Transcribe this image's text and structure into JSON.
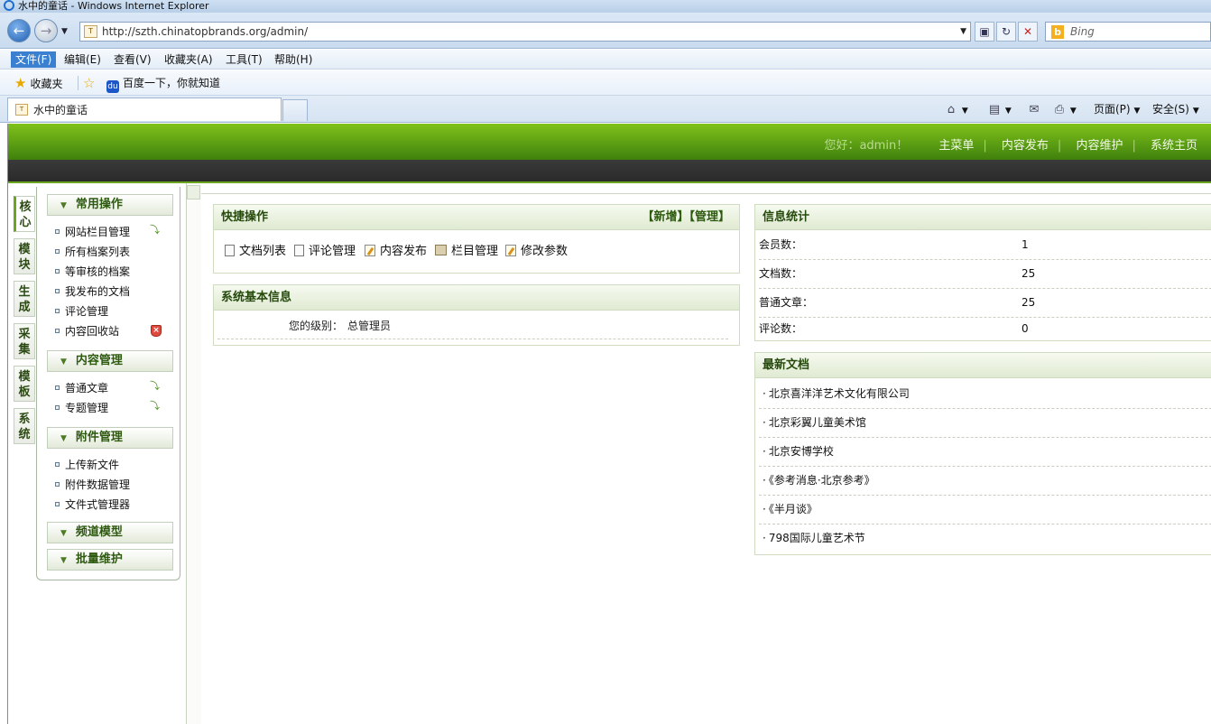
{
  "window": {
    "title": "水中的童话 - Windows Internet Explorer"
  },
  "addressbar": {
    "url": "http://szth.chinatopbrands.org/admin/",
    "search_placeholder": "Bing",
    "favicon_text": "T"
  },
  "menubar": {
    "items": [
      "文件(F)",
      "编辑(E)",
      "查看(V)",
      "收藏夹(A)",
      "工具(T)",
      "帮助(H)"
    ]
  },
  "favbar": {
    "favorites_label": "收藏夹",
    "link1": "百度一下，你就知道"
  },
  "tabbar": {
    "tab_title": "水中的童话",
    "page_menu": "页面(P)",
    "safety_menu": "安全(S)"
  },
  "header": {
    "greeting": "您好：admin！",
    "links": [
      "主菜单",
      "内容发布",
      "内容维护",
      "系统主页"
    ]
  },
  "side_tabs": [
    "核\n心",
    "模\n块",
    "生\n成",
    "采\n集",
    "模\n板",
    "系\n统"
  ],
  "side_menu": {
    "groups": [
      {
        "title": "常用操作",
        "items": [
          "网站栏目管理",
          "所有档案列表",
          "等审核的档案",
          "我发布的文档",
          "评论管理",
          "内容回收站"
        ]
      },
      {
        "title": "内容管理",
        "items": [
          "普通文章",
          "专题管理"
        ]
      },
      {
        "title": "附件管理",
        "items": [
          "上传新文件",
          "附件数据管理",
          "文件式管理器"
        ]
      },
      {
        "title": "频道模型",
        "items": []
      },
      {
        "title": "批量维护",
        "items": []
      }
    ]
  },
  "quick_ops": {
    "title": "快捷操作",
    "actions": "【新增】【管理】",
    "items": [
      "文档列表",
      "评论管理",
      "内容发布",
      "栏目管理",
      "修改参数"
    ]
  },
  "sys_info": {
    "title": "系统基本信息",
    "level_label": "您的级别：",
    "level_value": "总管理员"
  },
  "stats": {
    "title": "信息统计",
    "rows": [
      {
        "label": "会员数：",
        "value": "1"
      },
      {
        "label": "文档数：",
        "value": "25"
      },
      {
        "label": "普通文章：",
        "value": "25"
      },
      {
        "label": "评论数：",
        "value": "0"
      }
    ]
  },
  "latest": {
    "title": "最新文档",
    "items": [
      "北京喜洋洋艺术文化有限公司",
      "北京彩翼儿童美术馆",
      "北京安博学校",
      "《参考消息·北京参考》",
      "《半月谈》",
      "798国际儿童艺术节"
    ]
  }
}
